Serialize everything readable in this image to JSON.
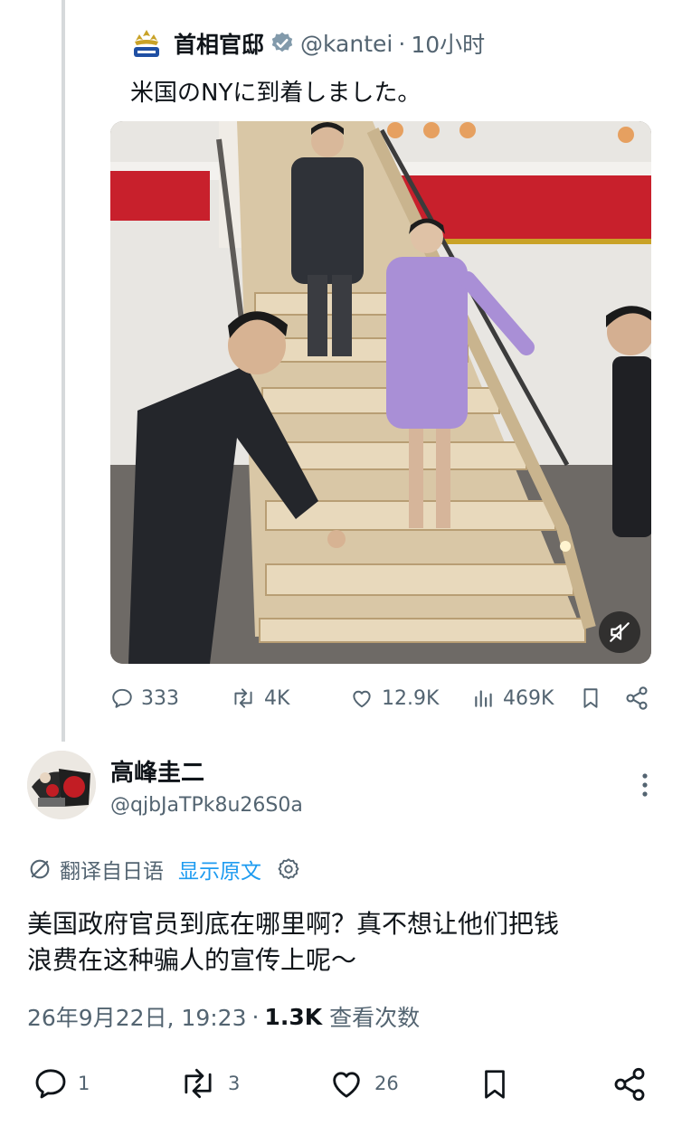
{
  "quoted": {
    "name": "首相官邸",
    "handle": "@kantei",
    "separator": "·",
    "time": "10小时",
    "text": "米国のNYに到着しました。",
    "stats": {
      "replies": "333",
      "reposts": "4K",
      "likes": "12.9K",
      "views": "469K"
    }
  },
  "reply": {
    "name": "高峰圭二",
    "handle": "@qjbJaTPk8u26S0a",
    "translate_label": "翻译自日语",
    "show_original": "显示原文",
    "text_line1": "美国政府官员到底在哪里啊？真不想让他们把钱",
    "text_line2": "浪费在这种骗人的宣传上呢～",
    "datetime": "26年9月22日, 19:23",
    "dot": "·",
    "views_count": "1.3K",
    "views_label": "查看次数",
    "stats": {
      "replies": "1",
      "reposts": "3",
      "likes": "26"
    }
  },
  "colors": {
    "text_primary": "#0f1419",
    "text_secondary": "#536471",
    "link": "#1d9bf0",
    "verified": "#829aab",
    "thread_line": "#d6d9db"
  },
  "icons": [
    "kantei-logo-icon",
    "verified-badge-icon",
    "mute-icon",
    "reply-icon",
    "repost-icon",
    "like-icon",
    "views-icon",
    "bookmark-icon",
    "share-icon",
    "more-icon",
    "translate-icon",
    "settings-icon"
  ]
}
